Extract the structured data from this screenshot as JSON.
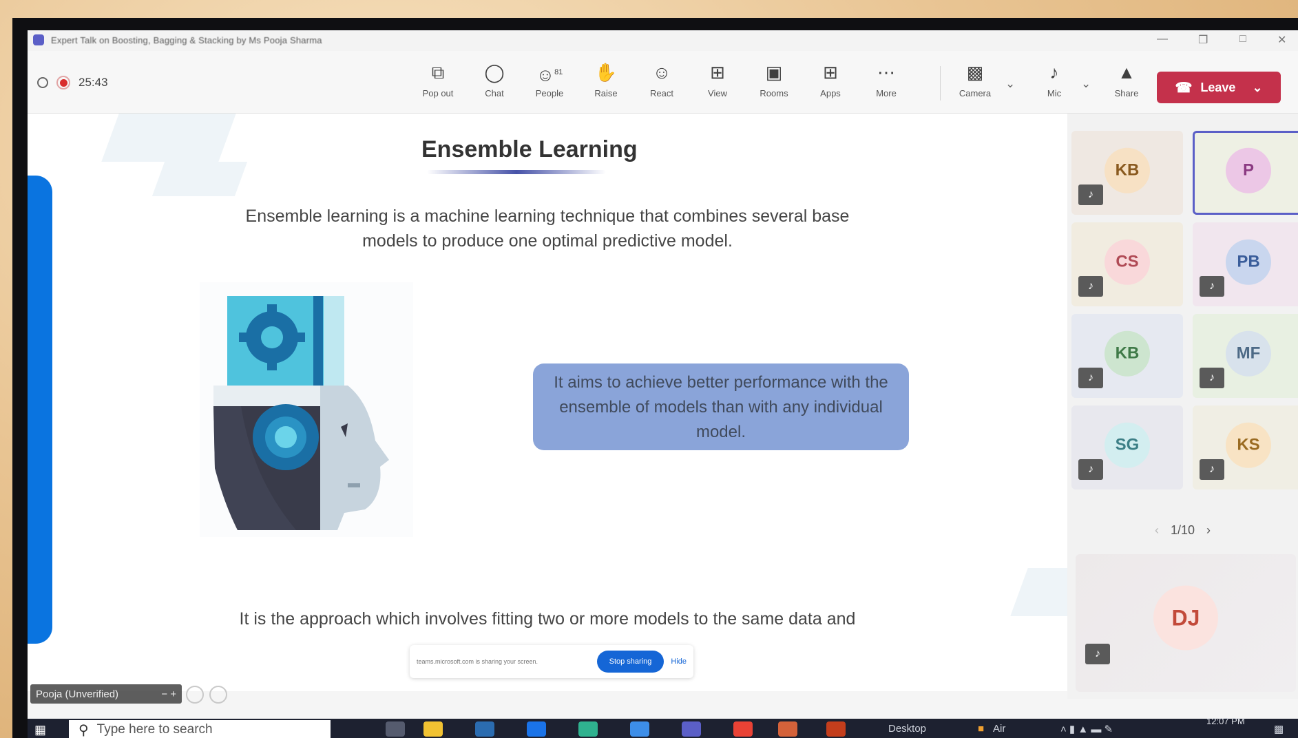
{
  "window": {
    "title": "Expert Talk on Boosting, Bagging & Stacking by Ms Pooja Sharma"
  },
  "call": {
    "elapsed": "25:43"
  },
  "toolbar": {
    "popout": "Pop out",
    "chat": "Chat",
    "people": "People",
    "people_count": "81",
    "raise": "Raise",
    "react": "React",
    "view": "View",
    "rooms": "Rooms",
    "apps": "Apps",
    "more": "More",
    "camera": "Camera",
    "mic": "Mic",
    "share": "Share",
    "leave": "Leave"
  },
  "slide": {
    "title": "Ensemble Learning",
    "description": "Ensemble learning is a machine learning technique that combines several base models to produce one optimal predictive model.",
    "callout": "It aims to achieve better performance with the ensemble of models than with any individual model.",
    "bottom_text": "It is the approach which involves fitting two or more models to the same data and"
  },
  "share_bar": {
    "message": "teams.microsoft.com is sharing your screen.",
    "stop": "Stop sharing",
    "hide": "Hide"
  },
  "presenter": {
    "name": "Pooja (Unverified)"
  },
  "participants": [
    {
      "initials": "KB",
      "bg": "#f7e1c4",
      "fg": "#8a5a1f",
      "tile": "#efe8e2"
    },
    {
      "initials": "P",
      "bg": "#ecc7e6",
      "fg": "#8b3a82",
      "tile": "#eef0e4",
      "active": true
    },
    {
      "initials": "CS",
      "bg": "#f9d8da",
      "fg": "#b04a55",
      "tile": "#f1ece0"
    },
    {
      "initials": "PB",
      "bg": "#c9d6ee",
      "fg": "#3a5d9a",
      "tile": "#f1e6ee"
    },
    {
      "initials": "KB",
      "bg": "#cde5cf",
      "fg": "#3f7a48",
      "tile": "#e6e9f1"
    },
    {
      "initials": "MF",
      "bg": "#d8e2ec",
      "fg": "#4d6a86",
      "tile": "#e8f0e2"
    },
    {
      "initials": "SG",
      "bg": "#d3eef0",
      "fg": "#3d7f86",
      "tile": "#e8e8ee"
    },
    {
      "initials": "KS",
      "bg": "#f8e3c4",
      "fg": "#9a6b22",
      "tile": "#f0eee4"
    }
  ],
  "pager": {
    "label": "1/10"
  },
  "featured": {
    "initials": "DJ"
  },
  "taskbar": {
    "search_placeholder": "Type here to search",
    "desktop": "Desktop",
    "air": "Air",
    "time": "12:07 PM"
  }
}
